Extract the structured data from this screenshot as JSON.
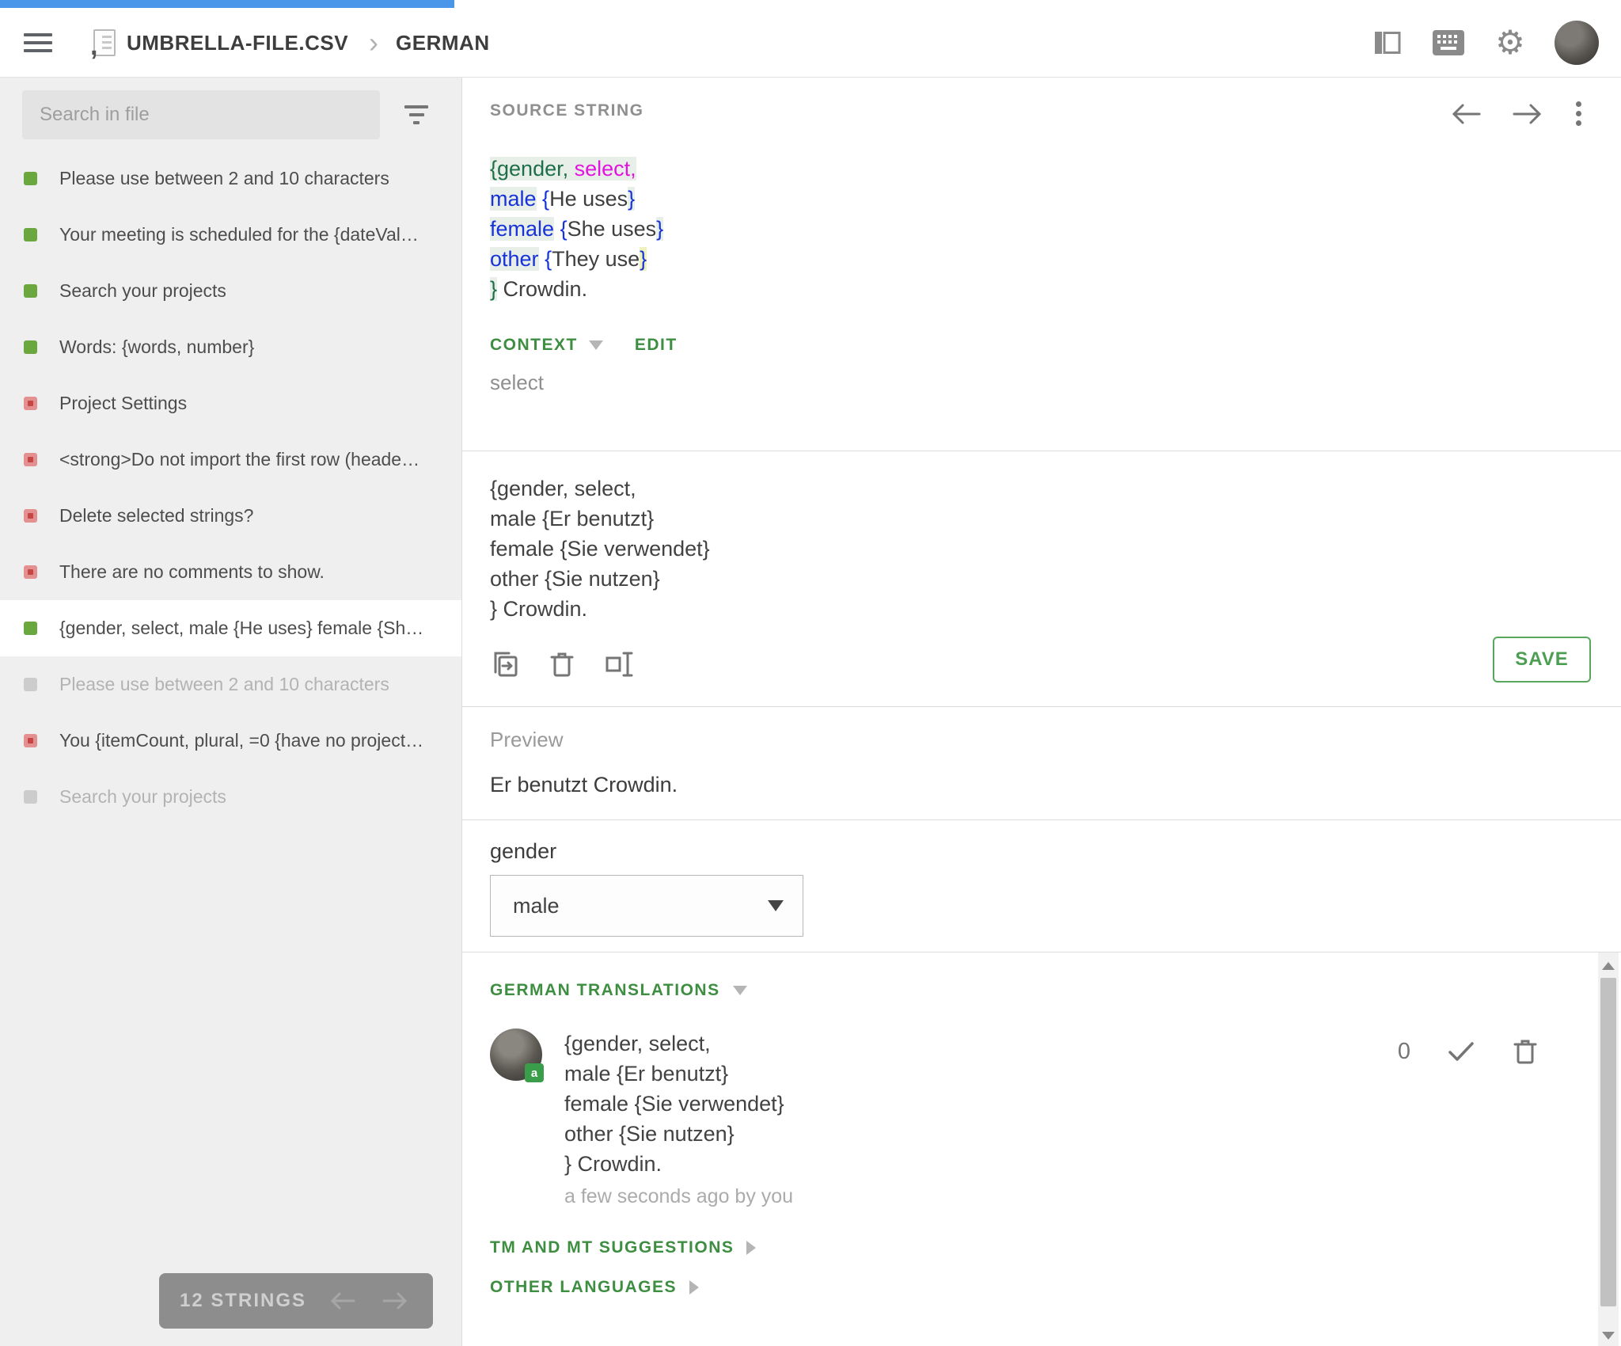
{
  "topbar": {
    "file_name": "UMBRELLA-FILE.CSV",
    "language": "GERMAN"
  },
  "sidebar": {
    "search_placeholder": "Search in file",
    "items": [
      {
        "label": "Please use between 2 and 10 characters",
        "status": "translated"
      },
      {
        "label": "Your meeting is scheduled for the {dateVal…",
        "status": "translated"
      },
      {
        "label": "Search your projects",
        "status": "translated"
      },
      {
        "label": "Words: {words, number}",
        "status": "translated"
      },
      {
        "label": "Project Settings",
        "status": "untranslated"
      },
      {
        "label": "<strong>Do not import the first row (heade…",
        "status": "untranslated"
      },
      {
        "label": "Delete selected strings?",
        "status": "untranslated"
      },
      {
        "label": "There are no comments to show.",
        "status": "untranslated"
      },
      {
        "label": "{gender, select, male {He uses} female {Sh…",
        "status": "translated",
        "selected": true
      },
      {
        "label": "Please use between 2 and 10 characters",
        "status": "inactive"
      },
      {
        "label": "You {itemCount, plural, =0 {have no project…",
        "status": "untranslated"
      },
      {
        "label": "Search your projects",
        "status": "inactive"
      }
    ],
    "strings_count_label": "12 STRINGS"
  },
  "source_panel": {
    "title": "SOURCE STRING",
    "lines": [
      [
        {
          "t": "{gender,",
          "c": "green",
          "h": "g"
        },
        {
          "t": " ",
          "c": "text",
          "h": "g"
        },
        {
          "t": "select,",
          "c": "magenta",
          "h": "g"
        }
      ],
      [
        {
          "t": "male",
          "c": "blue",
          "h": "g"
        },
        {
          "t": " ",
          "c": "text"
        },
        {
          "t": "{",
          "c": "blue"
        },
        {
          "t": "He uses",
          "c": "text"
        },
        {
          "t": "}",
          "c": "blue",
          "h": "g"
        }
      ],
      [
        {
          "t": "female",
          "c": "blue",
          "h": "g"
        },
        {
          "t": " ",
          "c": "text"
        },
        {
          "t": "{",
          "c": "blue"
        },
        {
          "t": "She uses",
          "c": "text"
        },
        {
          "t": "}",
          "c": "blue",
          "h": "g"
        }
      ],
      [
        {
          "t": "other",
          "c": "blue",
          "h": "g"
        },
        {
          "t": " ",
          "c": "text"
        },
        {
          "t": "{",
          "c": "blue"
        },
        {
          "t": "They use",
          "c": "text"
        },
        {
          "t": "}",
          "c": "blue",
          "h": "y"
        }
      ],
      [
        {
          "t": "}",
          "c": "green",
          "h": "g"
        },
        {
          "t": " Crowdin.",
          "c": "text"
        }
      ]
    ],
    "context_label": "CONTEXT",
    "edit_label": "EDIT",
    "context_value": "select"
  },
  "translation_panel": {
    "value": "{gender, select,\nmale {Er benutzt}\nfemale {Sie verwendet}\nother {Sie nutzen}\n} Crowdin.",
    "save_label": "SAVE"
  },
  "preview_panel": {
    "title": "Preview",
    "preview_text": "Er benutzt Crowdin.",
    "param_name": "gender",
    "param_value": "male"
  },
  "translations_panel": {
    "title": "GERMAN TRANSLATIONS",
    "entries": [
      {
        "text": "{gender, select,\nmale {Er benutzt}\nfemale {Sie verwendet}\nother {Sie nutzen}\n} Crowdin.",
        "meta": "a few seconds ago by you",
        "votes": "0",
        "badge": "a"
      }
    ],
    "tm_label": "TM AND MT SUGGESTIONS",
    "other_label": "OTHER LANGUAGES"
  },
  "colors": {
    "progress_blue": "#4a97e9",
    "accent_green": "#3e8e41",
    "save_green": "#57a85c",
    "status_translated": "#6aa83f",
    "status_untranslated": "#c64545",
    "status_inactive": "#cccccc",
    "icu_keyword_green": "#1e6f47",
    "icu_select_magenta": "#e213df",
    "icu_variant_blue": "#1733d9",
    "token_highlight": "#e8efe9",
    "cursor_highlight_yellow": "#eef3bd"
  }
}
